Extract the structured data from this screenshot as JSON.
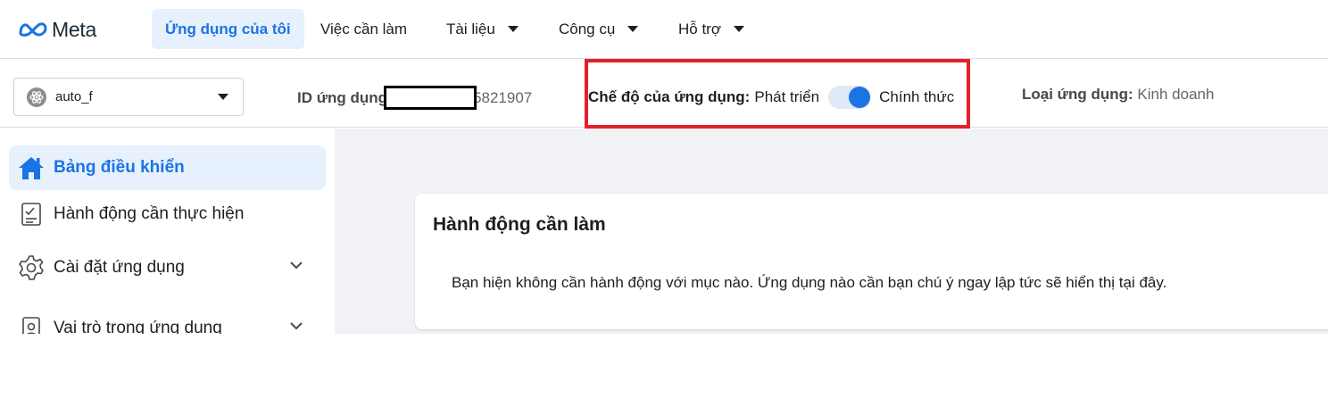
{
  "brand": {
    "name": "Meta",
    "color": "#1b74e4"
  },
  "nav": {
    "tabs": [
      {
        "label": "Ứng dụng của tôi",
        "active": true
      },
      {
        "label": "Việc cần làm"
      },
      {
        "label": "Tài liệu",
        "dropdown": true
      },
      {
        "label": "Công cụ",
        "dropdown": true
      },
      {
        "label": "Hỗ trợ",
        "dropdown": true
      }
    ]
  },
  "app": {
    "selector_name": "auto_f",
    "id_label": "ID ứng dụng",
    "id_visible_suffix": "5821907",
    "mode_label": "Chế độ của ứng dụng:",
    "mode_dev": "Phát triển",
    "mode_live": "Chính thức",
    "mode_live_on": true,
    "type_label": "Loại ứng dụng:",
    "type_value": "Kinh doanh"
  },
  "sidebar": {
    "items": [
      {
        "label": "Bảng điều khiển",
        "icon": "home-icon",
        "active": true
      },
      {
        "label": "Hành động cần thực hiện",
        "icon": "checklist-icon"
      },
      {
        "label": "Cài đặt ứng dụng",
        "icon": "gear-icon",
        "expandable": true
      },
      {
        "label": "Vai trò trong ứng dụng",
        "icon": "id-badge-icon",
        "expandable": true
      }
    ]
  },
  "main": {
    "card_title": "Hành động cần làm",
    "card_body": "Bạn hiện không cần hành động với mục nào. Ứng dụng nào cần bạn chú ý ngay lập tức sẽ hiển thị tại đây."
  },
  "colors": {
    "accent": "#1b74e4",
    "highlight_box": "#e3202b",
    "active_bg": "#e7f0fd"
  }
}
